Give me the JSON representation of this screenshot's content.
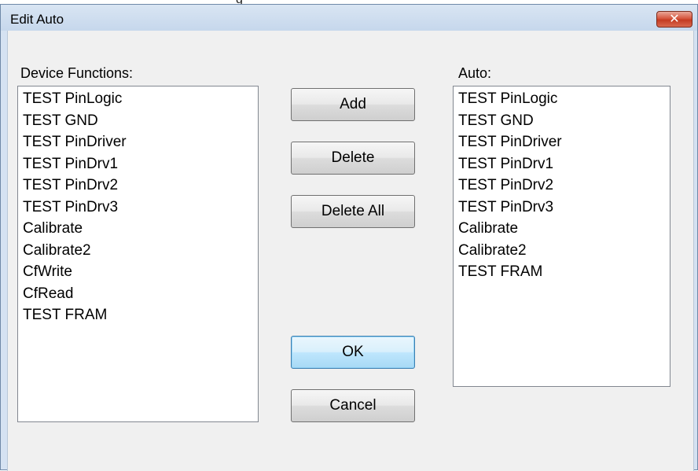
{
  "parent_glyph": "g",
  "dialog": {
    "title": "Edit Auto",
    "close_label": "✕"
  },
  "device_functions": {
    "label": "Device Functions:",
    "items": [
      "TEST PinLogic",
      "TEST GND",
      "TEST PinDriver",
      "TEST PinDrv1",
      "TEST PinDrv2",
      "TEST PinDrv3",
      "Calibrate",
      "Calibrate2",
      "CfWrite",
      "CfRead",
      "TEST FRAM"
    ]
  },
  "auto": {
    "label": "Auto:",
    "items": [
      "TEST PinLogic",
      "TEST GND",
      "TEST PinDriver",
      "TEST PinDrv1",
      "TEST PinDrv2",
      "TEST PinDrv3",
      "Calibrate",
      "Calibrate2",
      "TEST FRAM"
    ]
  },
  "buttons": {
    "add": "Add",
    "delete": "Delete",
    "delete_all": "Delete All",
    "ok": "OK",
    "cancel": "Cancel"
  }
}
